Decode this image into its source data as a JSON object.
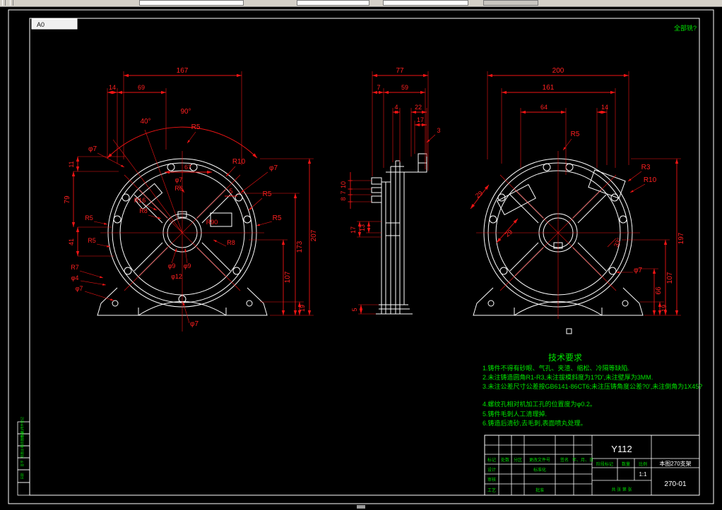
{
  "sheet": {
    "size": "A0",
    "corner_note": "全部铣?"
  },
  "dims": {
    "front": {
      "d167": "167",
      "d14": "14",
      "d69": "69",
      "a90": "90°",
      "a40": "40°",
      "r5_top": "R5",
      "dia7_tl": "φ7",
      "d67": "67",
      "r10": "R10",
      "dia7_tr": "φ7",
      "dia7_c": "φ7",
      "r6": "R6",
      "r16": "R16",
      "r8": "R8",
      "r90": "R90",
      "d5": "5",
      "r5_r1": "R5",
      "r5_r2": "R5",
      "d11": "11",
      "d79": "79",
      "d41": "41",
      "r5_l1": "R5",
      "r5_l2": "R5",
      "r7": "R7",
      "dia4": "φ4",
      "dia7_l": "φ7",
      "dia9_1": "φ9",
      "dia9_2": "φ9",
      "dia12": "φ12",
      "r8_b": "R8",
      "dia7_b": "φ7",
      "d207": "207",
      "d173": "173",
      "d107": "107",
      "d19": "19"
    },
    "side": {
      "d77": "77",
      "d7": "7",
      "d59": "59",
      "d4": "4",
      "d22": "22",
      "d17": "17",
      "d3": "3",
      "d10": "10",
      "d7b": "7",
      "d8": "8",
      "d17b": "17",
      "d13": "13",
      "d5": "5"
    },
    "rear": {
      "d200": "200",
      "d161": "161",
      "d64": "64",
      "d14": "14",
      "r5": "R5",
      "r3": "R3",
      "r10": "R10",
      "d29a": "29",
      "d29b": "29",
      "a33": "33°",
      "dia7": "φ7",
      "d197": "197",
      "d107": "107",
      "d66": "66",
      "d19": "19"
    }
  },
  "tech": {
    "title": "技术要求",
    "lines": [
      "1.铸件不得有砂眼、气孔、夹渣、缩松、冷隔等缺陷.",
      "2.未注铸造圆角R1-R3,未注拔模斜度为1?D',未注壁厚为3MM.",
      "3.未注公差尺寸公差按GB6141-86CT6;未注压铸角度公差?0',未注倒角为1X45?",
      "4.螺纹孔相对机加工孔的位置度为φ0.2。",
      "5.铸件毛刺人工清理掉.",
      "6.铸造后清砂,去毛刺,表面喷丸处理。"
    ]
  },
  "titleblock": {
    "model": "Y112",
    "drawing_no": "270-01",
    "name": "本图270支架",
    "scale_value": "1:1",
    "sheets": "共 张 第 张",
    "headers": {
      "mark": "标记",
      "count": "处数",
      "zone": "分区",
      "doc": "更改文件号",
      "sign": "签名",
      "date": "年、月、日"
    },
    "rows": {
      "design": "设计",
      "check": "审核",
      "process": "工艺",
      "std": "标准化",
      "approve": "批准"
    },
    "cells": {
      "stage": "阶段标记",
      "qty": "数量",
      "scale": "比例"
    }
  },
  "strips": {
    "labels": [
      "借(通)用件登记",
      "旧底图总号",
      "底图总号",
      "签字",
      "日期",
      ""
    ]
  }
}
